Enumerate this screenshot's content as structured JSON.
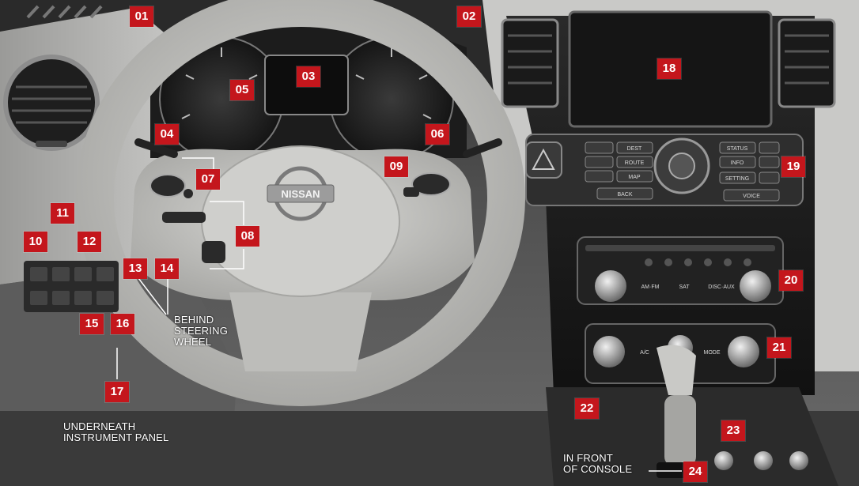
{
  "colors": {
    "callout_fill": "#c4161c",
    "callout_text": "#ffffff",
    "note_text": "#ffffff"
  },
  "callouts": [
    {
      "id": "01",
      "label": "01"
    },
    {
      "id": "02",
      "label": "02"
    },
    {
      "id": "03",
      "label": "03"
    },
    {
      "id": "04",
      "label": "04"
    },
    {
      "id": "05",
      "label": "05"
    },
    {
      "id": "06",
      "label": "06"
    },
    {
      "id": "07",
      "label": "07"
    },
    {
      "id": "08",
      "label": "08"
    },
    {
      "id": "09",
      "label": "09"
    },
    {
      "id": "10",
      "label": "10"
    },
    {
      "id": "11",
      "label": "11"
    },
    {
      "id": "12",
      "label": "12"
    },
    {
      "id": "13",
      "label": "13"
    },
    {
      "id": "14",
      "label": "14"
    },
    {
      "id": "15",
      "label": "15"
    },
    {
      "id": "16",
      "label": "16"
    },
    {
      "id": "17",
      "label": "17"
    },
    {
      "id": "18",
      "label": "18"
    },
    {
      "id": "19",
      "label": "19"
    },
    {
      "id": "20",
      "label": "20"
    },
    {
      "id": "21",
      "label": "21"
    },
    {
      "id": "22",
      "label": "22"
    },
    {
      "id": "23",
      "label": "23"
    },
    {
      "id": "24",
      "label": "24"
    }
  ],
  "notes": {
    "behind_wheel": [
      "BEHIND",
      "STEERING",
      "WHEEL"
    ],
    "under_panel": [
      "UNDERNEATH",
      "INSTRUMENT PANEL"
    ],
    "front_console": [
      "IN FRONT",
      "OF CONSOLE"
    ]
  },
  "dashboard_text": {
    "brand_badge": "NISSAN",
    "nav_buttons": [
      "DEST",
      "ROUTE",
      "MAP",
      "STATUS",
      "INFO",
      "SETTING",
      "BACK",
      "VOICE"
    ],
    "audio_buttons": [
      "AM·FM",
      "SAT",
      "DISC·AUX"
    ],
    "climate_buttons": [
      "A/C",
      "MODE"
    ]
  }
}
